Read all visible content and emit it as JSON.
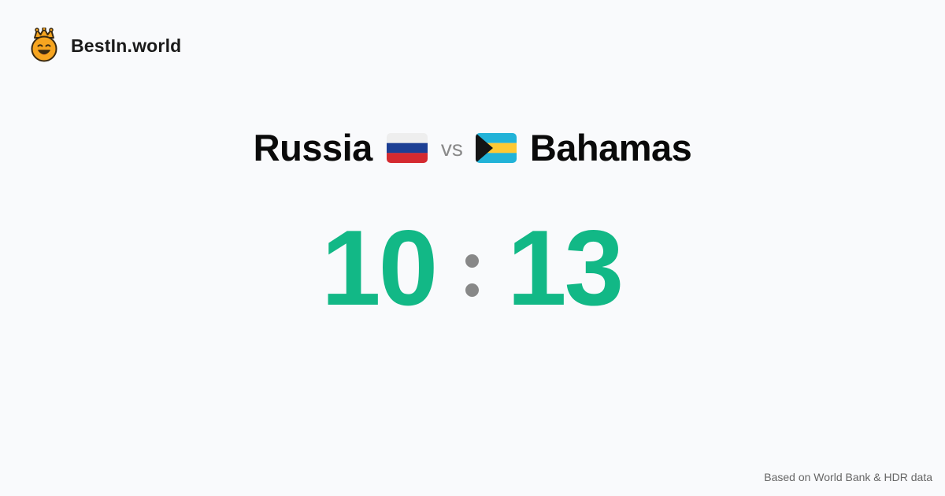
{
  "brand": {
    "name": "BestIn.world",
    "logo_icon": "crowned-smiley-icon"
  },
  "matchup": {
    "left_country": "Russia",
    "left_flag": "russia-flag-icon",
    "vs_label": "vs",
    "right_country": "Bahamas",
    "right_flag": "bahamas-flag-icon"
  },
  "score": {
    "left": "10",
    "right": "13",
    "color": "#12b886"
  },
  "footer": {
    "source": "Based on World Bank & HDR data"
  }
}
